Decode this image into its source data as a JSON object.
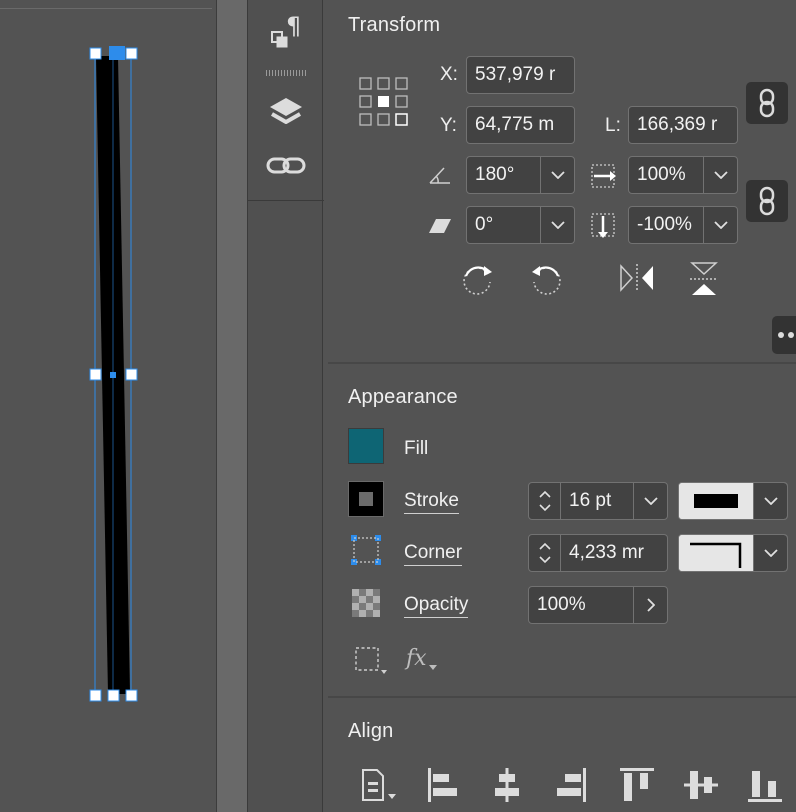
{
  "transform": {
    "title": "Transform",
    "x_label": "X:",
    "x_value": "537,979 r",
    "y_label": "Y:",
    "y_value": "64,775 m",
    "l_label": "L:",
    "l_value": "166,369 r",
    "rotation_value": "180°",
    "scale_x_value": "100%",
    "shear_value": "0°",
    "scale_y_value": "-100%"
  },
  "appearance": {
    "title": "Appearance",
    "fill_label": "Fill",
    "fill_color": "#0e6574",
    "stroke_label": "Stroke",
    "stroke_value": "16 pt",
    "corner_label": "Corner",
    "corner_value": "4,233 mr",
    "opacity_label": "Opacity",
    "opacity_value": "100%",
    "fx_label": "fx"
  },
  "align": {
    "title": "Align"
  },
  "colors": {
    "accent": "#2d8ceb",
    "panel_bg": "#535353",
    "field_bg": "#424242"
  }
}
